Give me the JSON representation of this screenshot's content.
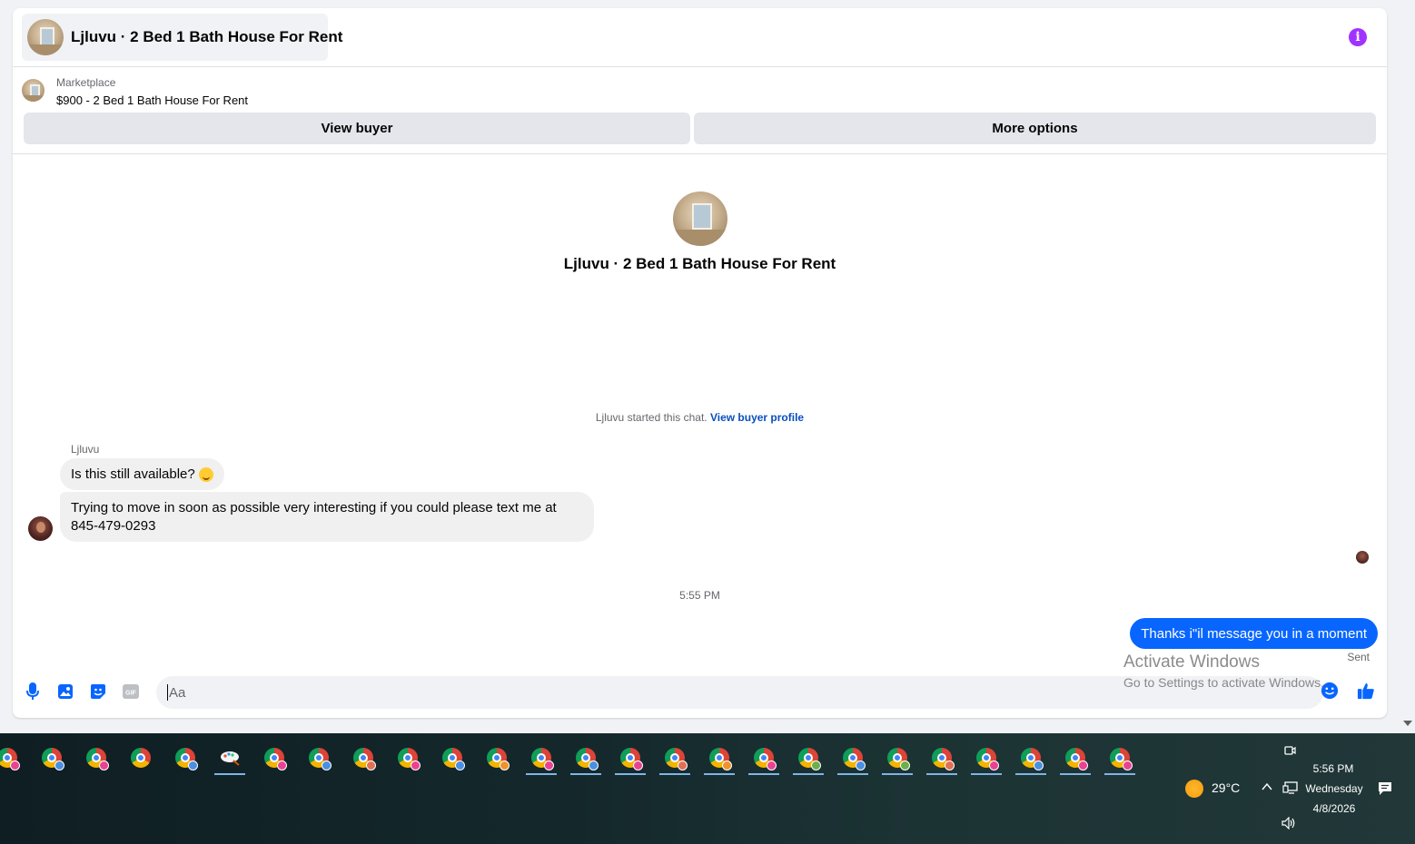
{
  "header": {
    "title": "Ljluvu · 2 Bed 1 Bath House For Rent",
    "info_icon": "info-icon"
  },
  "listing": {
    "label": "Marketplace",
    "title": "$900 - 2 Bed 1 Bath House For Rent"
  },
  "actions": {
    "view_buyer": "View buyer",
    "more_options": "More options"
  },
  "profile": {
    "name": "Ljluvu · 2 Bed 1 Bath House For Rent"
  },
  "chat": {
    "started_text": "Ljluvu started this chat.",
    "view_profile_link": "View buyer profile",
    "sender_name": "Ljluvu",
    "incoming": [
      "Is this still available?",
      "Trying to move in soon as possible very interesting if you could please text me at 845-479-0293"
    ],
    "timestamp": "5:55 PM",
    "outgoing": "Thanks i\"il message you in a moment",
    "status": "Sent"
  },
  "composer": {
    "placeholder": "Aa",
    "tools": [
      "microphone-icon",
      "image-icon",
      "sticker-icon",
      "gif-icon",
      "emoji-icon",
      "like-icon"
    ],
    "gif_label": "GIF",
    "accent": "#0866ff"
  },
  "watermark": {
    "line1": "Activate Windows",
    "line2": "Go to Settings to activate Windows."
  },
  "taskbar": {
    "weather": "29°C",
    "time": "5:56 PM",
    "day": "Wednesday",
    "date": "4/8/2026"
  }
}
